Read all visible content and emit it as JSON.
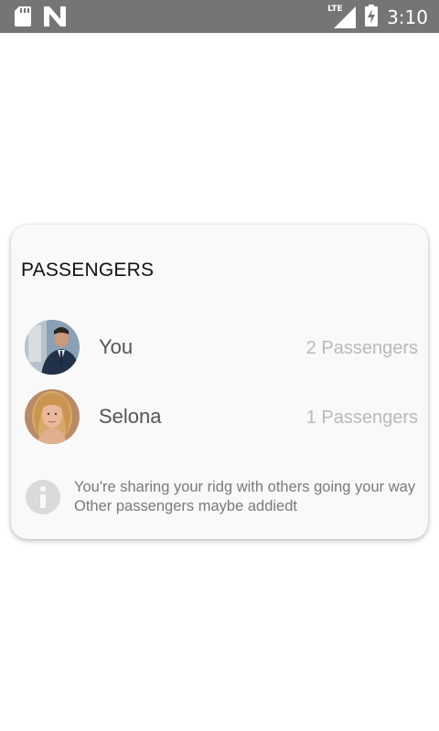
{
  "status_bar": {
    "time": "3:10",
    "network": "LTE",
    "icons": [
      "sd-card-icon",
      "n-logo-icon",
      "lte-signal-icon",
      "battery-charging-icon"
    ]
  },
  "card": {
    "title": "PASSENGERS",
    "passengers": [
      {
        "name": "You",
        "count": "2 Passengers",
        "avatar": "man-in-suit-photo"
      },
      {
        "name": "Selona",
        "count": "1 Passengers",
        "avatar": "blonde-woman-photo"
      }
    ],
    "info": {
      "icon": "info-icon",
      "line1": "You're sharing your ridg with others going your way",
      "line2": "Other passengers maybe addiedt"
    }
  },
  "colors": {
    "status_bar_bg": "#757575",
    "card_bg": "#f9f9f9",
    "name_text": "#555555",
    "count_text": "#b9b9b9",
    "info_text": "#7a7a7a"
  }
}
